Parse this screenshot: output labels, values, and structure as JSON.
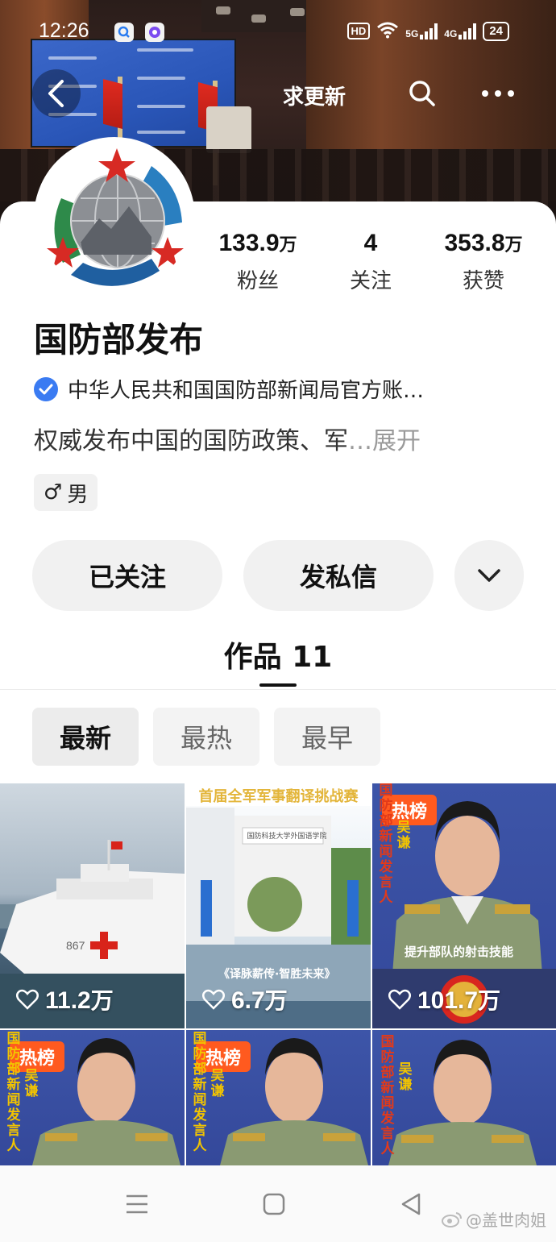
{
  "status_bar": {
    "time": "12:26",
    "network_hd": "HD",
    "sim1": "5G",
    "sim2": "4G",
    "battery": "24"
  },
  "nav": {
    "title": "求更新"
  },
  "profile": {
    "name": "国防部发布",
    "verified_text": "中华人民共和国国防部新闻局官方账…",
    "bio": "权威发布中国的国防政策、军",
    "bio_ellipsis": "…",
    "bio_expand": "展开",
    "gender_symbol": "♂",
    "gender": "男",
    "stats": [
      {
        "value": "133.9",
        "unit": "万",
        "label": "粉丝"
      },
      {
        "value": "4",
        "unit": "",
        "label": "关注"
      },
      {
        "value": "353.8",
        "unit": "万",
        "label": "获赞"
      }
    ]
  },
  "actions": {
    "follow": "已关注",
    "message": "发私信"
  },
  "tabs": {
    "works_label": "作品",
    "works_count": "11"
  },
  "sort": [
    "最新",
    "最热",
    "最早"
  ],
  "videos": [
    {
      "likes_num": "11.2",
      "likes_unit": "万",
      "hot": ""
    },
    {
      "likes_num": "6.7",
      "likes_unit": "万",
      "hot": "",
      "title": "首届全军军事翻译挑战赛",
      "sign": "国防科技大学外国语学院",
      "banner": "《译脉薪传·智胜未来》"
    },
    {
      "likes_num": "101.7",
      "likes_unit": "万",
      "hot": "热榜",
      "caption": "提升部队的射击技能",
      "side_text": "国防部新闻发言人",
      "side_name": "吴谦"
    },
    {
      "hot": "热榜",
      "side_text": "国防部新闻发言人",
      "side_name": "吴谦"
    },
    {
      "hot": "热榜",
      "side_text": "国防部新闻发言人",
      "side_name": "吴谦"
    },
    {
      "hot": "",
      "side_text": "国防部新闻发言人",
      "side_name": "吴谦"
    }
  ],
  "watermark": "@盖世肉姐",
  "colors": {
    "accent_verify": "#3a7bf2",
    "hot_badge": "#ff5a1f"
  }
}
